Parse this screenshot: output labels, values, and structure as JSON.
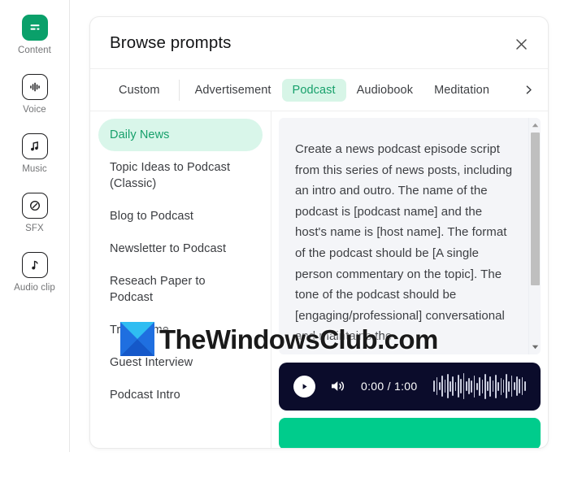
{
  "sidebar": {
    "items": [
      {
        "label": "Content",
        "icon": "content-icon",
        "active": true
      },
      {
        "label": "Voice",
        "icon": "voice-icon",
        "active": false
      },
      {
        "label": "Music",
        "icon": "music-icon",
        "active": false
      },
      {
        "label": "SFX",
        "icon": "sfx-icon",
        "active": false
      },
      {
        "label": "Audio clip",
        "icon": "audio-clip-icon",
        "active": false
      }
    ]
  },
  "modal": {
    "title": "Browse prompts",
    "close_label": "Close",
    "tabs": [
      {
        "label": "Custom",
        "selected": false
      },
      {
        "label": "Advertisement",
        "selected": false
      },
      {
        "label": "Podcast",
        "selected": true
      },
      {
        "label": "Audiobook",
        "selected": false
      },
      {
        "label": "Meditation",
        "selected": false
      }
    ],
    "tab_next_label": "More tabs",
    "prompt_list": [
      {
        "label": "Daily News",
        "selected": true
      },
      {
        "label": "Topic Ideas to Podcast (Classic)",
        "selected": false
      },
      {
        "label": "Blog to Podcast",
        "selected": false
      },
      {
        "label": "Newsletter to Podcast",
        "selected": false
      },
      {
        "label": "Reseach Paper to Podcast",
        "selected": false
      },
      {
        "label": "True Crime",
        "selected": false
      },
      {
        "label": "Guest Interview",
        "selected": false
      },
      {
        "label": "Podcast Intro",
        "selected": false
      }
    ],
    "prompt_text": "Create a news podcast episode script from this series of news posts, including an intro and outro. The name of the podcast is [podcast name] and the host's name is [host name]. The format of the podcast should be [A single person commentary on the topic]. The tone of the podcast should be [engaging/professional] conversational and maintains the",
    "player": {
      "current_time": "0:00",
      "separator": "/",
      "total_time": "1:00",
      "time_display": "0:00 / 1:00",
      "play_label": "Play",
      "volume_label": "Volume"
    },
    "cta_label": ""
  },
  "watermark": {
    "text": "TheWindowsClub.com"
  },
  "colors": {
    "accent_green": "#0aa06a",
    "tab_active_bg": "#d7f5e7",
    "tab_active_text": "#17a06b",
    "pill_active_bg": "#d9f6ea",
    "player_bg": "#0b0c2b",
    "cta_green": "#00cc8c",
    "prompt_bg": "#f4f5f8"
  }
}
